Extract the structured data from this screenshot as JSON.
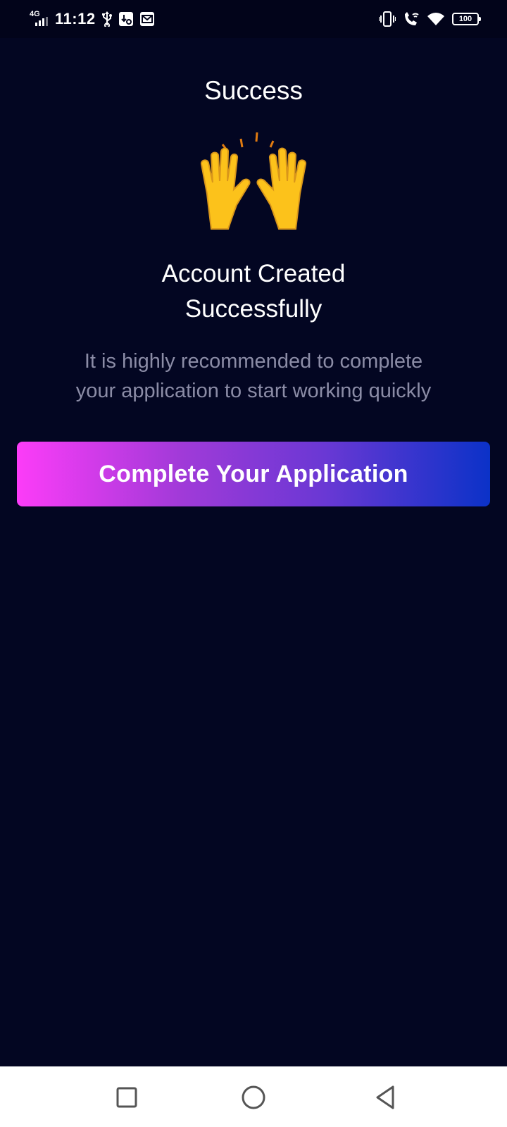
{
  "status_bar": {
    "network": "4G",
    "time": "11:12",
    "battery": "100",
    "icons": [
      "usb-icon",
      "download-icon",
      "mail-icon",
      "vibrate-icon",
      "wifi-call-icon",
      "wifi-icon",
      "battery-icon"
    ]
  },
  "page": {
    "title": "Success",
    "emoji_icon": "raising-hands-icon",
    "headline_line1": "Account Created",
    "headline_line2": "Successfully",
    "subtext_line1": "It is highly recommended to complete",
    "subtext_line2": "your application to start working quickly",
    "cta_label": "Complete Your Application"
  },
  "colors": {
    "background": "#030622",
    "text_primary": "#ffffff",
    "text_secondary": "#8b8ca6",
    "button_gradient_start": "#fc3cf8",
    "button_gradient_end": "#0b32c8"
  },
  "nav_bar": {
    "buttons": [
      "recent-apps-icon",
      "home-icon",
      "back-icon"
    ]
  }
}
